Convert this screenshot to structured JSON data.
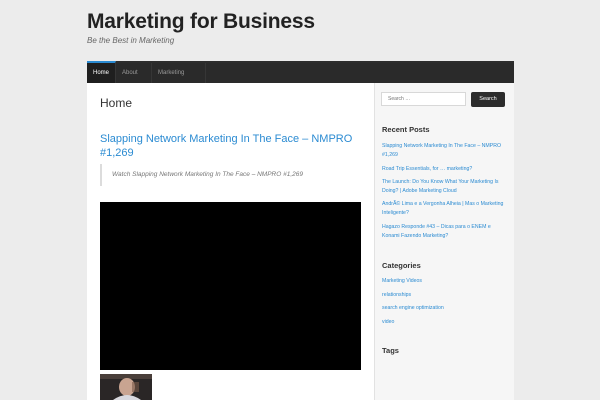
{
  "site": {
    "title": "Marketing for Business",
    "tagline": "Be the Best in Marketing"
  },
  "nav": {
    "items": [
      "Home",
      "About Us",
      "Marketing Videos"
    ],
    "active": "Home"
  },
  "main": {
    "page_title": "Home",
    "post_title": "Slapping Network Marketing In The Face – NMPRO #1,269",
    "quote": "Watch Slapping Network Marketing In The Face – NMPRO #1,269"
  },
  "sidebar": {
    "search": {
      "placeholder": "Search …",
      "button_label": "Search"
    },
    "recent_posts": {
      "title": "Recent Posts",
      "items": [
        "Slapping Network Marketing In The Face – NMPRO #1,269",
        "Road Trip Essentials, for … marketing?",
        "The Launch: Do You Know What Your Marketing Is Doing? | Adobe Marketing Cloud",
        "AndrÃ© Lima e a Vergonha Alheia | Mas o Marketing Inteligente?",
        "Hagazo Responde #43 – Dicas para o ENEM e Konami Fazendo Marketing?"
      ]
    },
    "categories": {
      "title": "Categories",
      "items": [
        "Marketing Videos",
        "relationships",
        "search engine optimization",
        "video"
      ]
    },
    "tags": {
      "title": "Tags"
    }
  },
  "colors": {
    "link": "#2b8bd2",
    "nav_bg": "#2a2a2a",
    "accent": "#2b8bd2"
  }
}
